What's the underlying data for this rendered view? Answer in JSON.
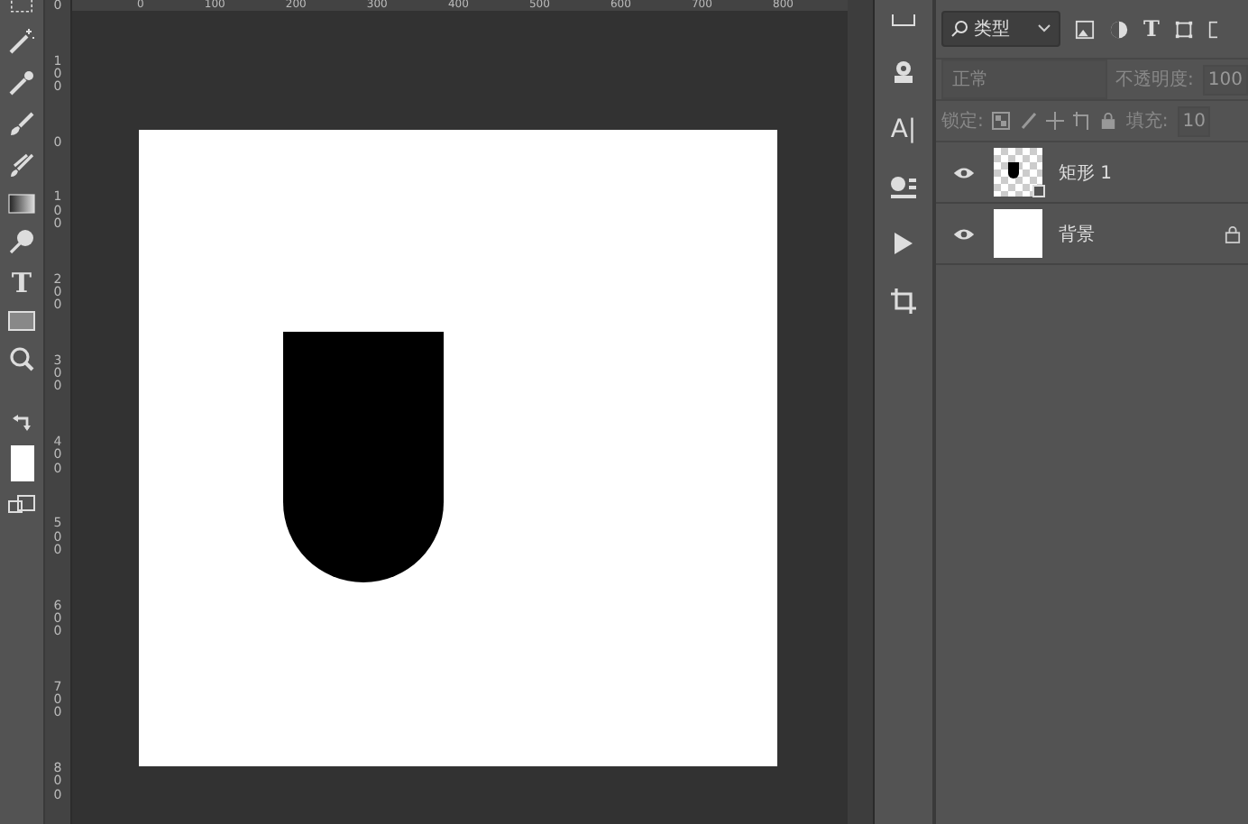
{
  "top_ruler": {
    "labels": [
      "0",
      "100",
      "200",
      "300",
      "400",
      "500",
      "600",
      "700",
      "800"
    ]
  },
  "left_ruler": {
    "labels": [
      "0",
      "100",
      "0",
      "100",
      "200",
      "300",
      "400",
      "500",
      "600",
      "700",
      "800"
    ]
  },
  "toolbar": {
    "type_tool_glyph": "T"
  },
  "panel_strip": {
    "character_glyph": "A|"
  },
  "layers_panel": {
    "filter": {
      "value": "类型"
    },
    "filter_type_glyph": "T",
    "blend_mode": {
      "value": "正常",
      "disabled": true
    },
    "opacity": {
      "label": "不透明度:",
      "value": "100",
      "disabled": true
    },
    "lock": {
      "label": "锁定:"
    },
    "fill": {
      "label": "填充:",
      "value": "10",
      "disabled": true
    },
    "layers": [
      {
        "name": "矩形 1",
        "kind": "shape",
        "visible": true,
        "locked": false
      },
      {
        "name": "背景",
        "kind": "background",
        "visible": true,
        "locked": true
      }
    ]
  }
}
